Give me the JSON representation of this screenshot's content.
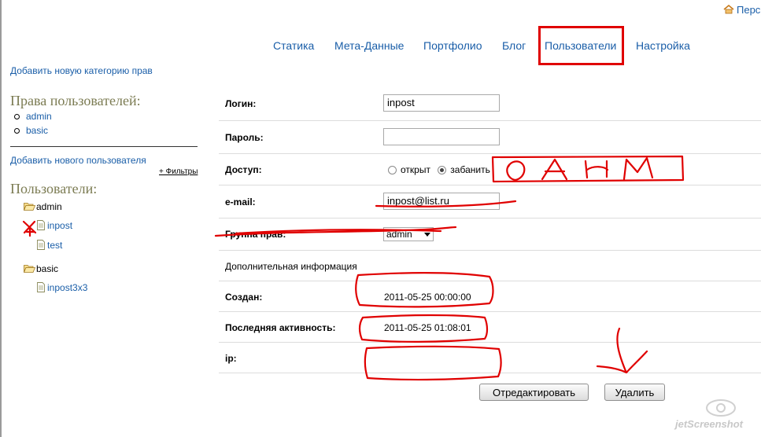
{
  "top_link": {
    "label": "Перс"
  },
  "nav": {
    "items": [
      "Статика",
      "Мета-Данные",
      "Портфолио",
      "Блог",
      "Пользователи",
      "Настройка"
    ],
    "active": "Пользователи"
  },
  "sidebar": {
    "add_category_link": "Добавить новую категорию прав",
    "rights_heading": "Права пользователей:",
    "rights": [
      "admin",
      "basic"
    ],
    "add_user_link": "Добавить нового пользователя",
    "filters_link": "+ Фильтры",
    "users_heading": "Пользователи:",
    "groups": [
      {
        "name": "admin",
        "users": [
          "inpost",
          "test"
        ]
      },
      {
        "name": "basic",
        "users": [
          "inpost3x3"
        ]
      }
    ]
  },
  "form": {
    "login_label": "Логин:",
    "login_value": "inpost",
    "password_label": "Пароль:",
    "password_value": "",
    "access_label": "Доступ:",
    "access_open": "открыт",
    "access_banned": "забанить",
    "access_selected": "забанить",
    "email_label": "e-mail:",
    "email_value": "inpost@list.ru",
    "group_label": "Группа прав:",
    "group_value": "admin",
    "extra_info": "Дополнительная информация",
    "created_label": "Создан:",
    "created_value": "2011-05-25 00:00:00",
    "last_activity_label": "Последняя активность:",
    "last_activity_value": "2011-05-25 01:08:01",
    "ip_label": "ip:",
    "ip_value": "",
    "edit_button": "Отредактировать",
    "delete_button": "Удалить"
  },
  "annotations": {
    "color": "#e00000",
    "handwritten_text": "DAHM"
  },
  "watermark": "jetScreenshot"
}
